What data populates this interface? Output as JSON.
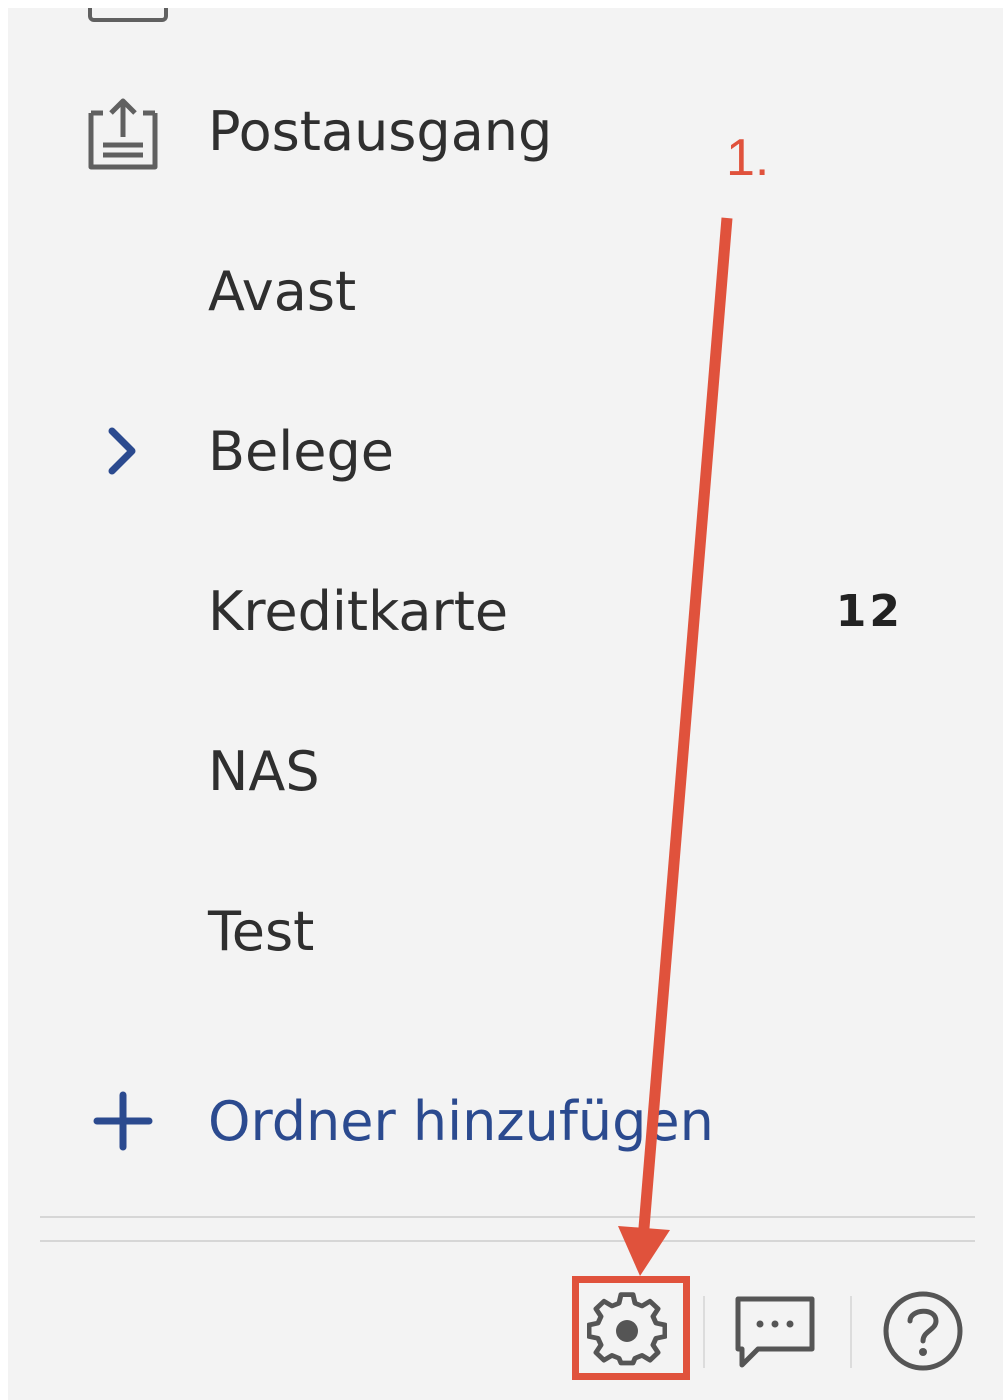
{
  "folders": [
    {
      "label": "Postausgang",
      "icon": "outbox-icon",
      "count": ""
    },
    {
      "label": "Avast",
      "icon": "",
      "count": ""
    },
    {
      "label": "Belege",
      "icon": "chevron-right-icon",
      "count": ""
    },
    {
      "label": "Kreditkarte",
      "icon": "",
      "count": "12"
    },
    {
      "label": "NAS",
      "icon": "",
      "count": ""
    },
    {
      "label": "Test",
      "icon": "",
      "count": ""
    }
  ],
  "add_folder": {
    "label": "Ordner hinzufügen",
    "icon": "plus-icon"
  },
  "footer": {
    "icons": [
      "gear-icon",
      "chat-icon",
      "help-icon"
    ]
  },
  "annotation": {
    "step_label": "1.",
    "color": "#e0523c"
  },
  "colors": {
    "accent": "#2b4a8f",
    "text": "#2f2f2f",
    "panel_background": "#f3f3f3",
    "icon_gray": "#606060"
  }
}
